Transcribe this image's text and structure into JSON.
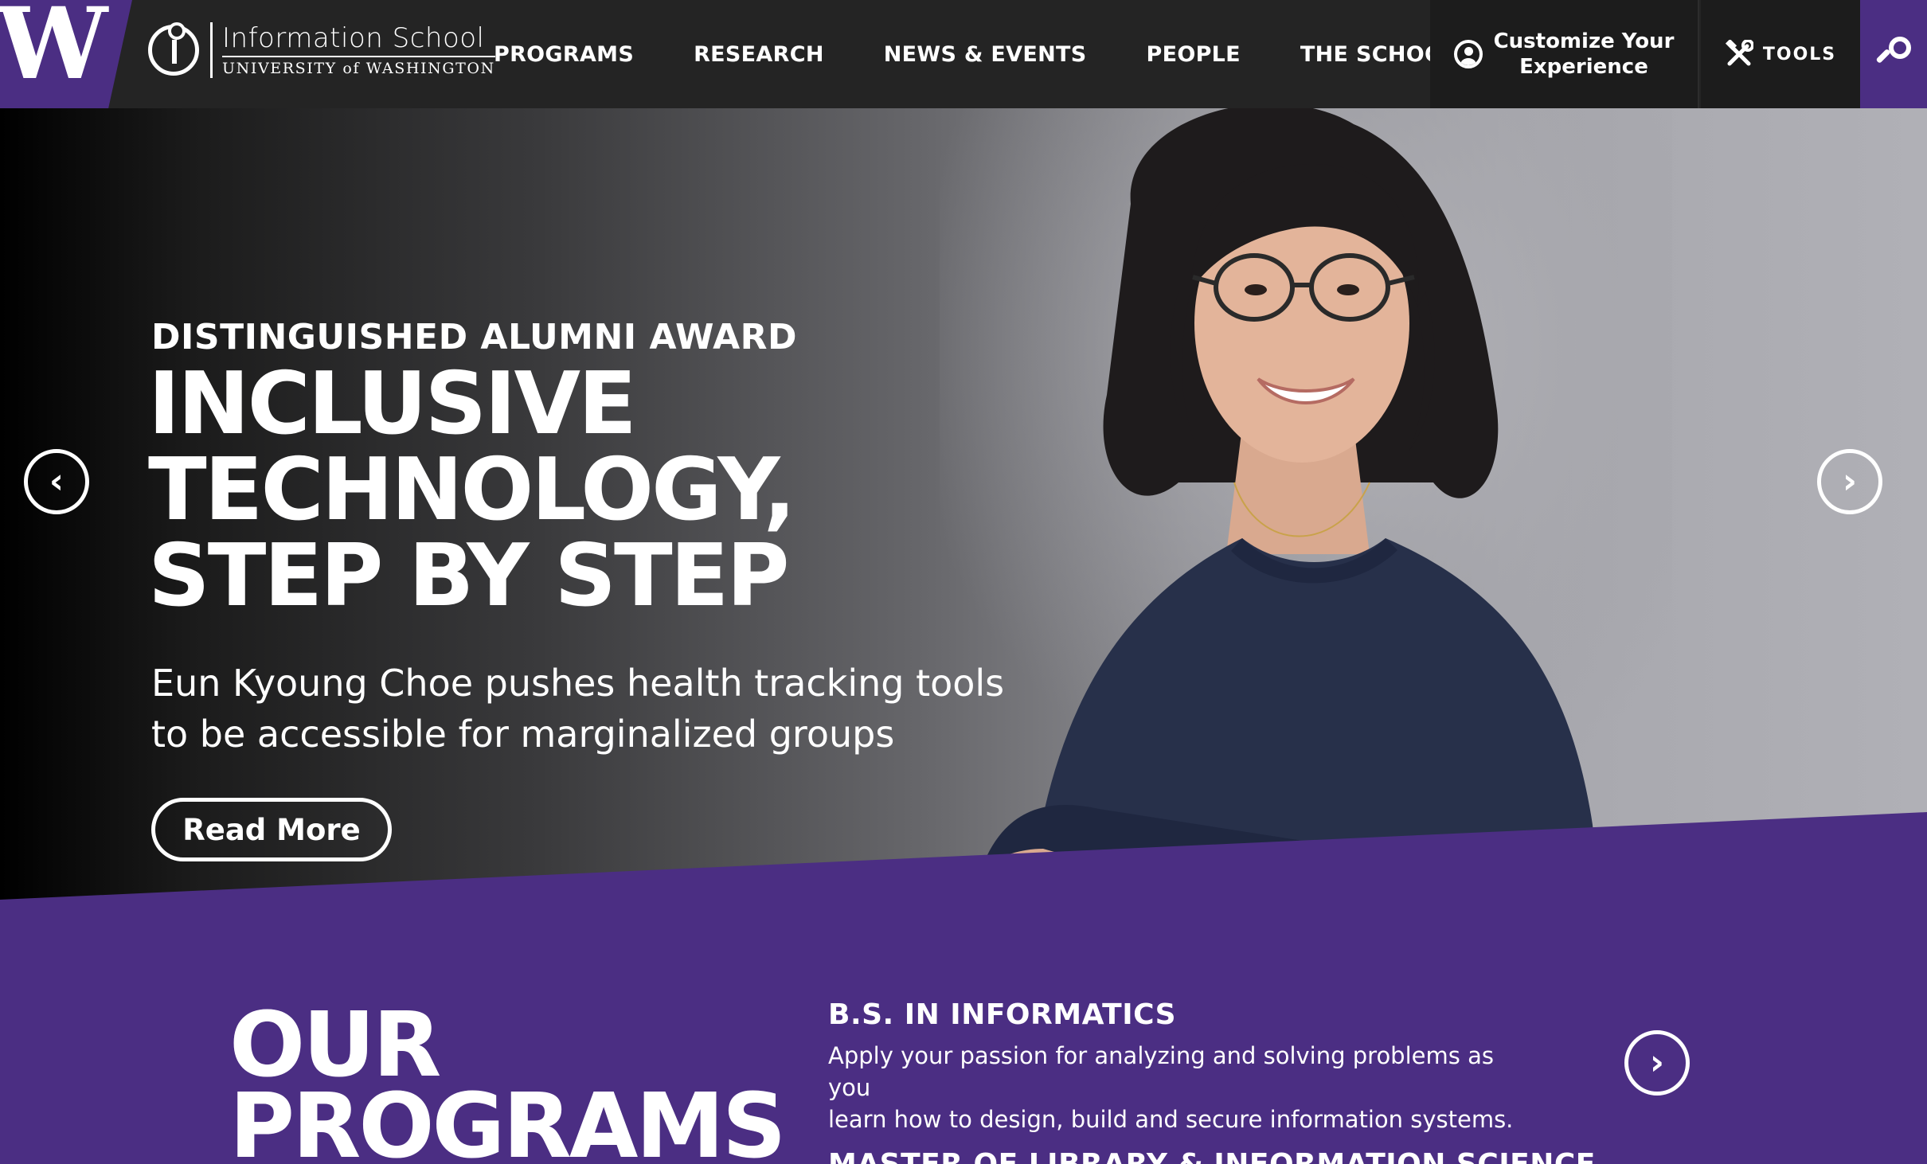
{
  "header": {
    "logo_letter": "W",
    "school_name": "Information School",
    "university_name": "UNIVERSITY of WASHINGTON",
    "nav": [
      {
        "label": "PROGRAMS"
      },
      {
        "label": "RESEARCH"
      },
      {
        "label": "NEWS & EVENTS"
      },
      {
        "label": "PEOPLE"
      },
      {
        "label": "THE SCHOOL"
      }
    ],
    "customize_label_line1": "Customize Your",
    "customize_label_line2": "Experience",
    "customize_icon": "user-circle-icon",
    "tools_label": "TOOLS",
    "tools_icon": "tools-icon",
    "search_icon": "search-icon"
  },
  "hero": {
    "eyebrow": "DISTINGUISHED ALUMNI AWARD",
    "headline_line1": "INCLUSIVE",
    "headline_line2": "TECHNOLOGY,",
    "headline_line3": "STEP BY STEP",
    "subhead_line1": "Eun Kyoung Choe pushes health tracking tools",
    "subhead_line2": "to be accessible for marginalized groups",
    "cta_label": "Read More",
    "prev_glyph": "‹",
    "next_glyph": "›"
  },
  "programs": {
    "heading_line1": "OUR",
    "heading_line2": "PROGRAMS",
    "items": [
      {
        "title": "B.S. IN INFORMATICS",
        "desc_line1": "Apply your passion for analyzing and solving problems as you",
        "desc_line2": "learn how to design, build and secure information systems."
      },
      {
        "title": "MASTER OF LIBRARY & INFORMATION SCIENCE"
      }
    ],
    "next_glyph": "›"
  },
  "colors": {
    "uw_purple": "#4b2e83",
    "header_bg": "#242424",
    "header_dark": "#1c1c1c"
  }
}
